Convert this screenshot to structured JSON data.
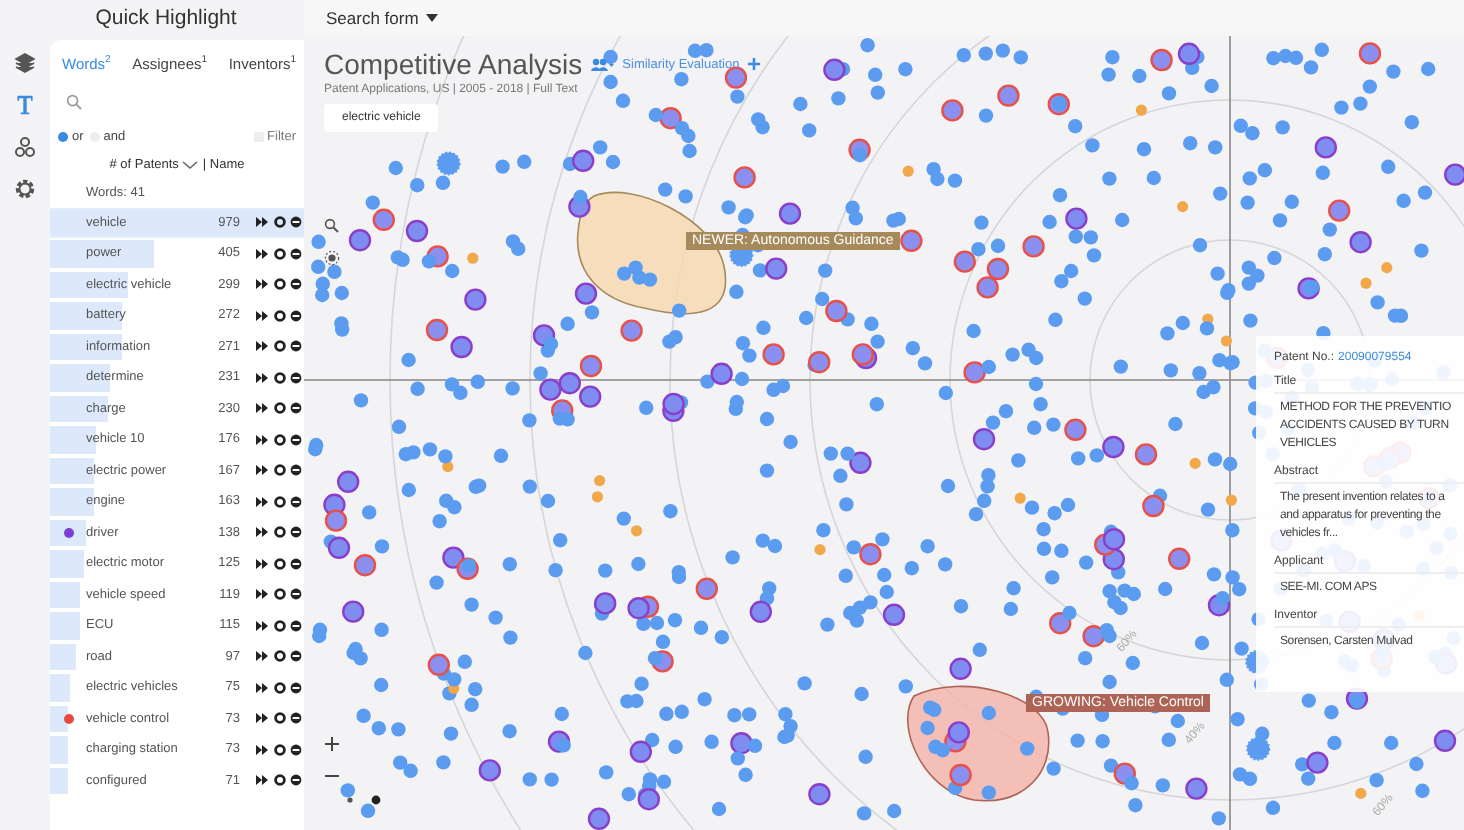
{
  "panel": {
    "title": "Quick Highlight"
  },
  "search_form": {
    "label": "Search form"
  },
  "tabs": [
    {
      "label": "Words",
      "count": "2",
      "selected": true
    },
    {
      "label": "Assignees",
      "count": "1",
      "selected": false
    },
    {
      "label": "Inventors",
      "count": "1",
      "selected": false
    }
  ],
  "match_mode": [
    {
      "label": "or",
      "selected": true
    },
    {
      "label": "and",
      "selected": false
    }
  ],
  "filter": {
    "label": "Filter",
    "checked": false
  },
  "sort": {
    "primary": "# of Patents",
    "secondary": "| Name"
  },
  "word_count": "Words: 41",
  "words": [
    {
      "name": "vehicle",
      "count": "979",
      "level": 1,
      "selected": true
    },
    {
      "name": "power",
      "count": "405",
      "level": 0.41,
      "selected": false
    },
    {
      "name": "electric vehicle",
      "count": "299",
      "level": 0.31,
      "selected": false
    },
    {
      "name": "battery",
      "count": "272",
      "level": 0.28,
      "selected": false
    },
    {
      "name": "information",
      "count": "271",
      "level": 0.28,
      "selected": false
    },
    {
      "name": "determine",
      "count": "231",
      "level": 0.24,
      "selected": false
    },
    {
      "name": "charge",
      "count": "230",
      "level": 0.23,
      "selected": false
    },
    {
      "name": "vehicle 10",
      "count": "176",
      "level": 0.18,
      "selected": false
    },
    {
      "name": "electric power",
      "count": "167",
      "level": 0.17,
      "selected": false
    },
    {
      "name": "engine",
      "count": "163",
      "level": 0.17,
      "selected": false
    },
    {
      "name": "driver",
      "count": "138",
      "level": 0.14,
      "selected": false,
      "color": "#7b3fd1"
    },
    {
      "name": "electric motor",
      "count": "125",
      "level": 0.13,
      "selected": false
    },
    {
      "name": "vehicle speed",
      "count": "119",
      "level": 0.12,
      "selected": false
    },
    {
      "name": "ECU",
      "count": "115",
      "level": 0.12,
      "selected": false
    },
    {
      "name": "road",
      "count": "97",
      "level": 0.1,
      "selected": false
    },
    {
      "name": "electric vehicles",
      "count": "75",
      "level": 0.08,
      "selected": false
    },
    {
      "name": "vehicle control",
      "count": "73",
      "level": 0.07,
      "selected": false,
      "color": "#e8493e"
    },
    {
      "name": "charging station",
      "count": "73",
      "level": 0.07,
      "selected": false
    },
    {
      "name": "configured",
      "count": "71",
      "level": 0.07,
      "selected": false
    }
  ],
  "analysis": {
    "title": "Competitive Analysis",
    "link": "Similarity Evaluation",
    "subtitle": "Patent Applications, US | 2005 - 2018 | Full Text",
    "query_chip": "electric vehicle"
  },
  "clusters": [
    {
      "kind": "newer",
      "label": "NEWER: Autonomous Guidance"
    },
    {
      "kind": "growing",
      "label": "GROWING: Vehicle Control"
    }
  ],
  "ring_labels": [
    "60%",
    "40%",
    "60%"
  ],
  "patent_card": {
    "number_label": "Patent No.:",
    "number": "20090079554",
    "fields": [
      {
        "label": "Title",
        "lines": [
          "METHOD FOR THE PREVENTIO",
          "ACCIDENTS CAUSED BY TURN",
          "VEHICLES"
        ]
      },
      {
        "label": "Abstract",
        "lines": [
          "The present invention relates to a",
          "and apparatus for preventing the",
          "vehicles fr..."
        ]
      },
      {
        "label": "Applicant",
        "lines": [
          "SEE-MI. COM APS"
        ]
      },
      {
        "label": "Inventor",
        "lines": [
          "Sorensen, Carsten Mulvad"
        ]
      }
    ]
  }
}
